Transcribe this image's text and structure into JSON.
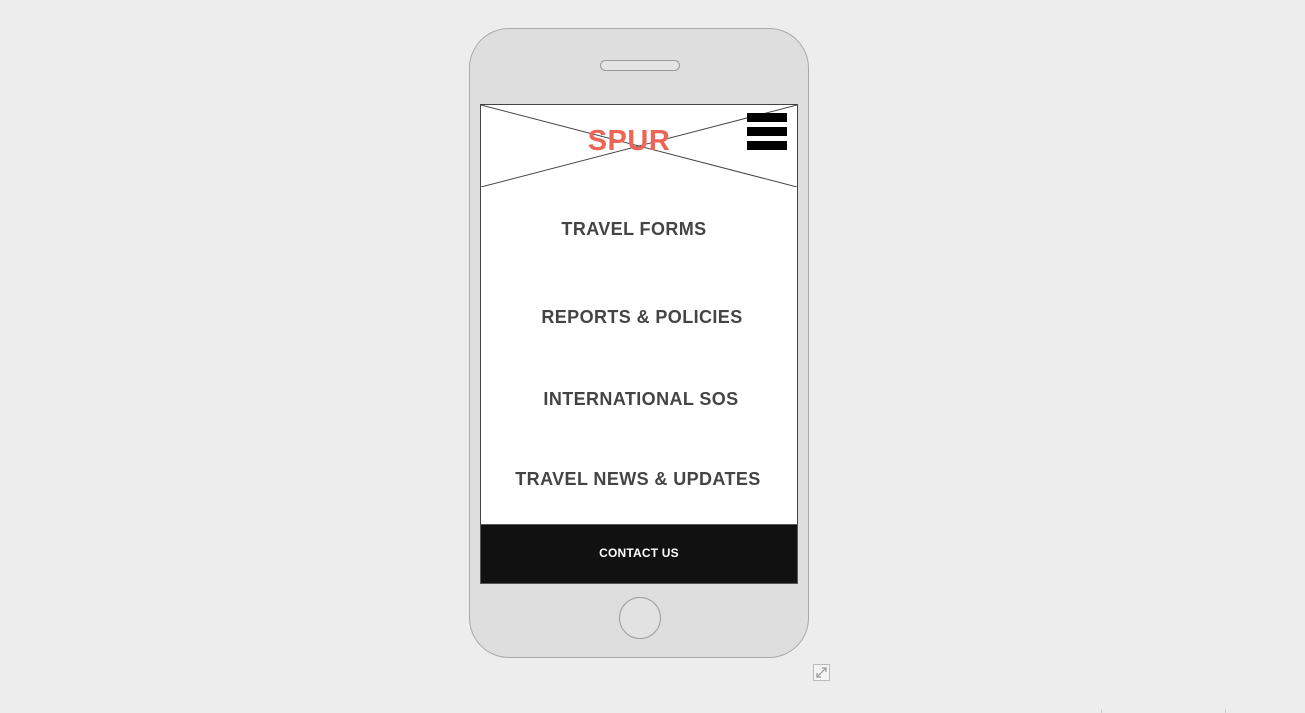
{
  "app": {
    "logo_text": "SPUR",
    "menu_icon": "hamburger-menu-icon",
    "expand_icon": "expand-icon"
  },
  "nav": {
    "items": [
      {
        "label": "TRAVEL FORMS"
      },
      {
        "label": "REPORTS & POLICIES"
      },
      {
        "label": "INTERNATIONAL SOS"
      },
      {
        "label": "TRAVEL NEWS & UPDATES"
      }
    ]
  },
  "footer": {
    "contact_label": "CONTACT US"
  },
  "colors": {
    "background": "#ededed",
    "phone_body": "#dedede",
    "logo": "#ee6555",
    "nav_text": "#444444",
    "contact_bg": "#111111",
    "contact_text": "#ffffff"
  }
}
